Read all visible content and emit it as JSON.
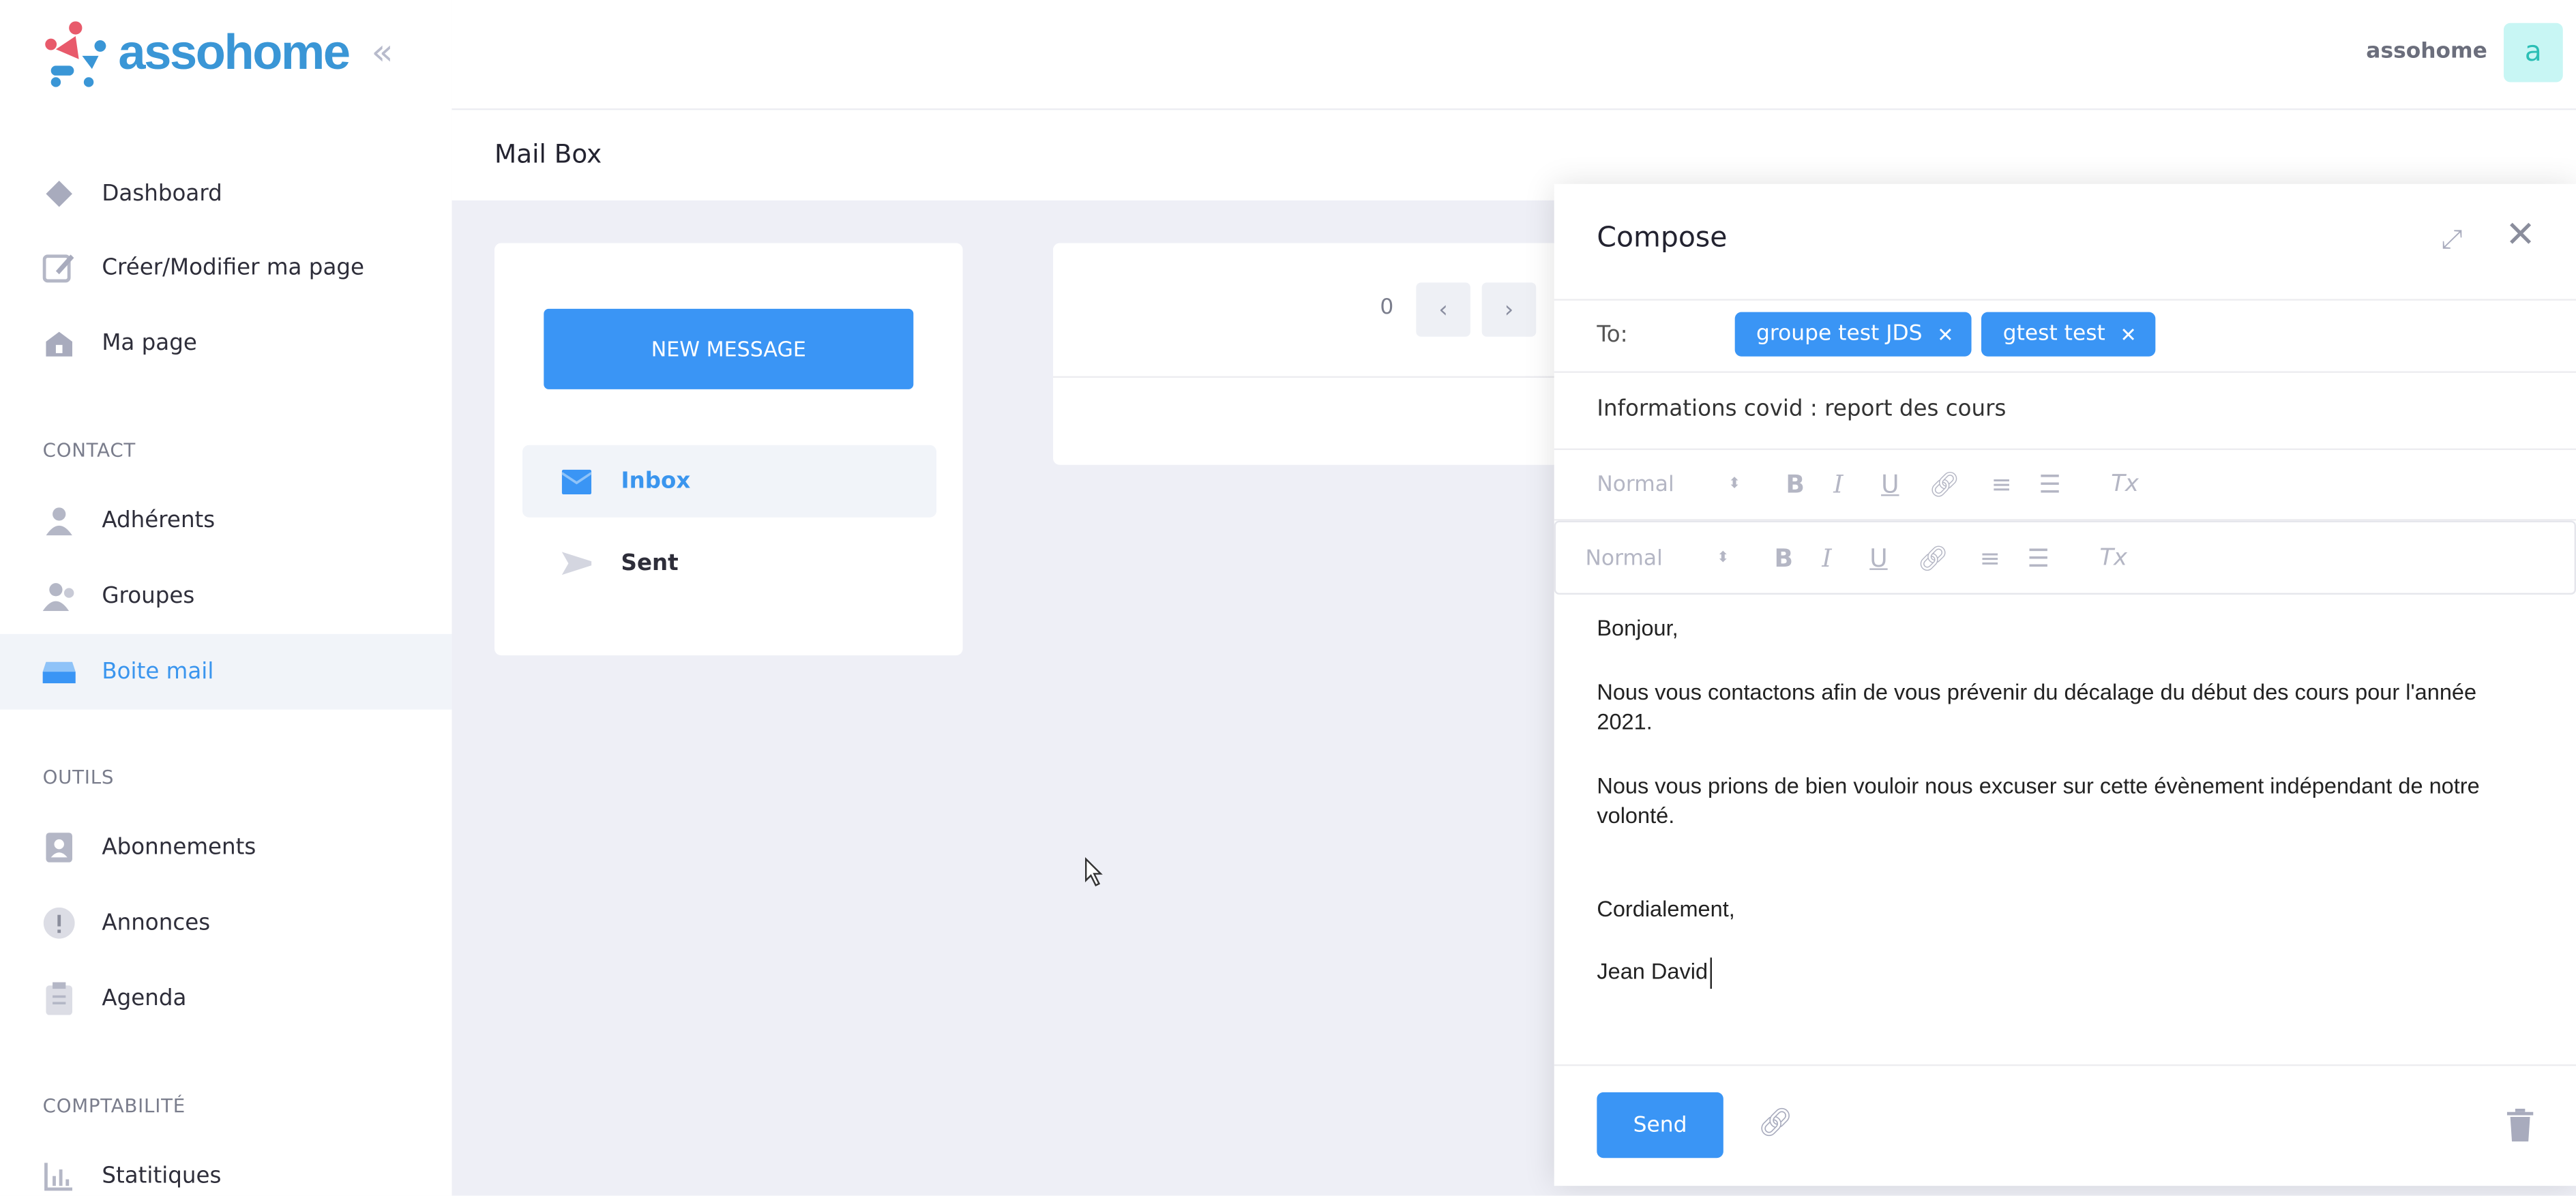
{
  "brand": {
    "name": "assohome",
    "colors": {
      "accent": "#3a95f5",
      "logo_red": "#e85a6b",
      "logo_blue": "#3a96d6"
    }
  },
  "topbar": {
    "username": "assohome",
    "avatar_letter": "a"
  },
  "sidebar": {
    "items": [
      {
        "label": "Dashboard",
        "icon": "diamond-icon"
      },
      {
        "label": "Créer/Modifier ma page",
        "icon": "edit-icon"
      },
      {
        "label": "Ma page",
        "icon": "home-icon"
      }
    ],
    "sections": [
      {
        "title": "CONTACT",
        "items": [
          {
            "label": "Adhérents",
            "icon": "user-icon"
          },
          {
            "label": "Groupes",
            "icon": "users-icon"
          },
          {
            "label": "Boite mail",
            "icon": "inbox-icon",
            "active": true
          }
        ]
      },
      {
        "title": "OUTILS",
        "items": [
          {
            "label": "Abonnements",
            "icon": "contact-card-icon"
          },
          {
            "label": "Annonces",
            "icon": "alert-icon"
          },
          {
            "label": "Agenda",
            "icon": "clipboard-icon"
          }
        ]
      },
      {
        "title": "COMPTABILITÉ",
        "items": [
          {
            "label": "Statitiques",
            "icon": "chart-icon"
          }
        ]
      }
    ]
  },
  "page": {
    "title": "Mail Box"
  },
  "mailbox": {
    "new_message": "NEW MESSAGE",
    "folders": [
      {
        "label": "Inbox",
        "active": true
      },
      {
        "label": "Sent"
      }
    ],
    "count": "0"
  },
  "compose": {
    "title": "Compose",
    "to_label": "To:",
    "recipients": [
      "groupe test JDS",
      "gtest test"
    ],
    "subject": "Informations covid : report des cours",
    "toolbar": {
      "format": "Normal",
      "bold": "B",
      "italic": "I",
      "underline": "U",
      "clear": "Tx"
    },
    "body": [
      "Bonjour,",
      "Nous vous contactons afin de vous prévenir du décalage du début des cours pour l'année 2021.",
      "Nous vous prions de bien vouloir nous excuser sur cette évènement indépendant de notre volonté.",
      "Cordialement,",
      "Jean David"
    ],
    "send": "Send"
  }
}
